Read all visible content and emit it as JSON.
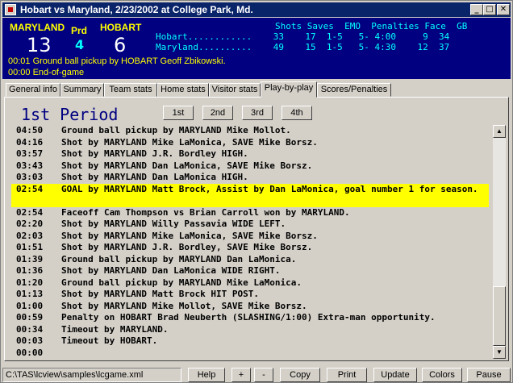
{
  "window": {
    "title": "Hobart vs Maryland, 2/23/2002 at College Park, Md.",
    "controls": {
      "minimize": "_",
      "maximize": "□",
      "close": "✕"
    }
  },
  "scoreboard": {
    "home_team": "MARYLAND",
    "home_score": "13",
    "period_label": "Prd",
    "period": "4",
    "visitor_team": "HOBART",
    "visitor_score": "6",
    "stats_header": "Shots Saves  EMO  Penalties Face  GB",
    "stats_rows": [
      "Hobart............    33    17  1-5   5- 4:00     9  34",
      "Maryland..........    49    15  1-5   5- 4:30    12  37"
    ],
    "status_lines": [
      "00:01  Ground ball pickup by HOBART Geoff Zbikowski.",
      "00:00  End-of-game"
    ]
  },
  "tabs": [
    {
      "label": "General info",
      "active": false
    },
    {
      "label": "Summary",
      "active": false
    },
    {
      "label": "Team stats",
      "active": false
    },
    {
      "label": "Home stats",
      "active": false
    },
    {
      "label": "Visitor stats",
      "active": false
    },
    {
      "label": "Play-by-play",
      "active": true
    },
    {
      "label": "Scores/Penalties",
      "active": false
    }
  ],
  "pbp": {
    "period_title": "1st Period",
    "period_buttons": [
      "1st",
      "2nd",
      "3rd",
      "4th"
    ],
    "plays": [
      {
        "time": "04:50",
        "text": "Ground ball pickup by MARYLAND Mike Mollot."
      },
      {
        "time": "04:16",
        "text": "Shot by MARYLAND Mike LaMonica, SAVE Mike Borsz."
      },
      {
        "time": "03:57",
        "text": "Shot by MARYLAND J.R. Bordley HIGH."
      },
      {
        "time": "03:43",
        "text": "Shot by MARYLAND Dan LaMonica, SAVE Mike Borsz."
      },
      {
        "time": "03:03",
        "text": "Shot by MARYLAND Dan LaMonica HIGH."
      },
      {
        "time": "02:54",
        "text": "GOAL by MARYLAND Matt Brock, Assist by Dan LaMonica, goal number 1 for season.",
        "highlight": true
      },
      {
        "time": "02:54",
        "text": "Faceoff Cam Thompson vs Brian Carroll won by MARYLAND."
      },
      {
        "time": "02:20",
        "text": "Shot by MARYLAND Willy Passavia WIDE LEFT."
      },
      {
        "time": "02:03",
        "text": "Shot by MARYLAND Mike LaMonica, SAVE Mike Borsz."
      },
      {
        "time": "01:51",
        "text": "Shot by MARYLAND J.R. Bordley, SAVE Mike Borsz."
      },
      {
        "time": "01:39",
        "text": "Ground ball pickup by MARYLAND Dan LaMonica."
      },
      {
        "time": "01:36",
        "text": "Shot by MARYLAND Dan LaMonica WIDE RIGHT."
      },
      {
        "time": "01:20",
        "text": "Ground ball pickup by MARYLAND Mike LaMonica."
      },
      {
        "time": "01:13",
        "text": "Shot by MARYLAND Matt Brock HIT POST."
      },
      {
        "time": "01:00",
        "text": "Shot by MARYLAND Mike Mollot, SAVE Mike Borsz."
      },
      {
        "time": "00:59",
        "text": "Penalty on HOBART Brad Neuberth (SLASHING/1:00) Extra-man opportunity."
      },
      {
        "time": "00:34",
        "text": "Timeout by MARYLAND."
      },
      {
        "time": "00:03",
        "text": "Timeout by HOBART."
      },
      {
        "time": "00:00",
        "text": ""
      }
    ]
  },
  "statusbar": {
    "path": "C:\\TAS\\lcview\\samples\\lcgame.xml",
    "buttons": [
      "Help",
      "+",
      "-",
      "Copy",
      "Print",
      "Update",
      "Colors",
      "Pause"
    ]
  },
  "colors": {
    "scoreboard_bg": "#000080",
    "title_bar": "#0a246a",
    "highlight": "#ffff00",
    "team_text": "#ffff00",
    "stat_text": "#00ffff"
  }
}
